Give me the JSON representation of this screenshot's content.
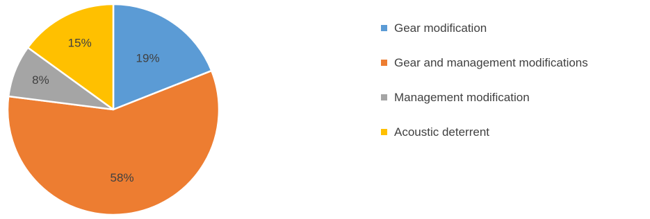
{
  "chart_data": {
    "type": "pie",
    "title": "",
    "start_angle_deg": 0,
    "direction": "clockwise",
    "legend_position": "right",
    "slices": [
      {
        "label": "Gear modification",
        "value": 19,
        "display": "19%",
        "color": "#5B9BD5"
      },
      {
        "label": "Gear and management modifications",
        "value": 58,
        "display": "58%",
        "color": "#ED7D31"
      },
      {
        "label": "Management modification",
        "value": 8,
        "display": "8%",
        "color": "#A5A5A5"
      },
      {
        "label": "Acoustic deterrent",
        "value": 15,
        "display": "15%",
        "color": "#FFC000"
      }
    ]
  }
}
